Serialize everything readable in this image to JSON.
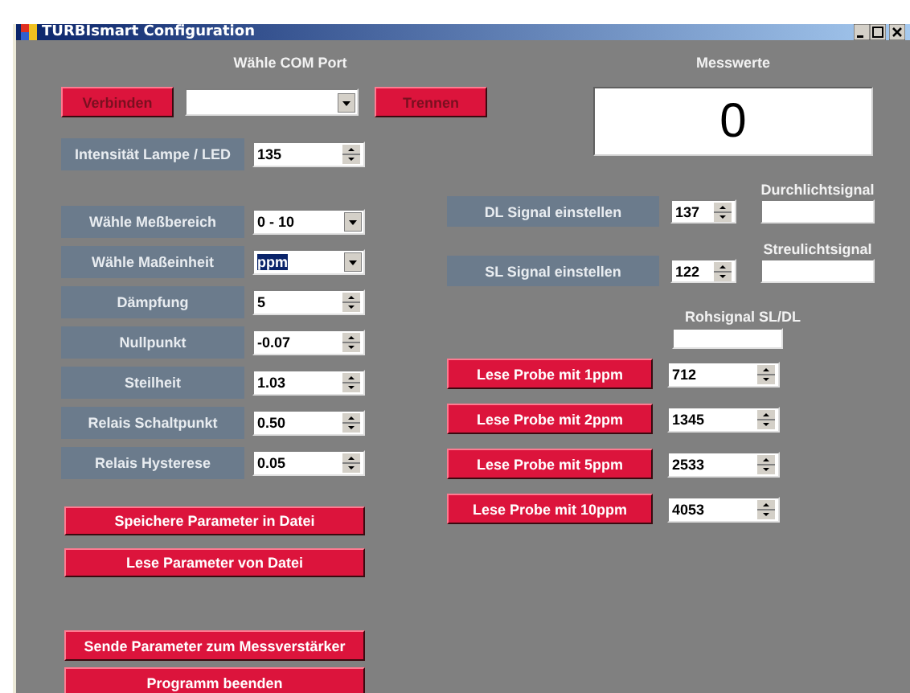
{
  "window": {
    "title": "TURBIsmart Configuration"
  },
  "com_port": {
    "title": "Wähle COM Port",
    "connect_button": "Verbinden",
    "disconnect_button": "Trennen"
  },
  "lamp_intensity": {
    "label": "Intensität Lampe / LED",
    "value": "135"
  },
  "parameters": [
    {
      "label": "Wähle Meßbereich",
      "value": "0 - 10",
      "kind": "dropdown",
      "highlighted": false
    },
    {
      "label": "Wähle Maßeinheit",
      "value": "ppm",
      "kind": "dropdown",
      "highlighted": true
    },
    {
      "label": "Dämpfung",
      "value": "5",
      "kind": "spinner",
      "highlighted": false
    },
    {
      "label": "Nullpunkt",
      "value": "-0.07",
      "kind": "spinner",
      "highlighted": false
    },
    {
      "label": "Steilheit",
      "value": "1.03",
      "kind": "spinner",
      "highlighted": false
    },
    {
      "label": "Relais Schaltpunkt",
      "value": "0.50",
      "kind": "spinner",
      "highlighted": false
    },
    {
      "label": "Relais Hysterese",
      "value": "0.05",
      "kind": "spinner",
      "highlighted": false
    }
  ],
  "file_buttons": [
    "Speichere Parameter in Datei",
    "Lese Parameter von Datei"
  ],
  "bottom_buttons": [
    "Sende Parameter zum Messverstärker",
    "Programm beenden"
  ],
  "measurement": {
    "title": "Messwerte",
    "value": "0"
  },
  "signals": [
    {
      "label": "DL Signal einstellen",
      "value": "137",
      "caption": "Durchlichtsignal"
    },
    {
      "label": "SL Signal einstellen",
      "value": "122",
      "caption": "Streulichtsignal"
    }
  ],
  "raw_signal": {
    "caption": "Rohsignal SL/DL"
  },
  "samples": [
    {
      "button": "Lese Probe mit 1ppm",
      "value": "712"
    },
    {
      "button": "Lese Probe mit 2ppm",
      "value": "1345"
    },
    {
      "button": "Lese Probe mit 5ppm",
      "value": "2533"
    },
    {
      "button": "Lese Probe mit 10ppm",
      "value": "4053"
    }
  ]
}
